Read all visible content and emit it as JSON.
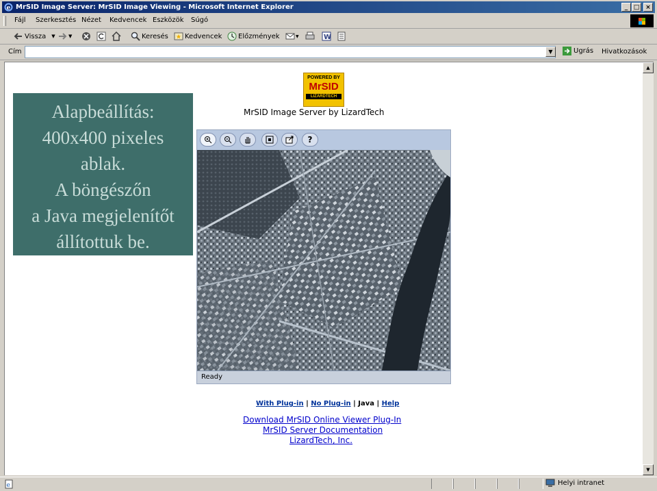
{
  "window": {
    "title": "MrSID Image Server: MrSID Image Viewing - Microsoft Internet Explorer",
    "minimize": "_",
    "maximize": "□",
    "close": "×"
  },
  "menu": [
    "Fájl",
    "Szerkesztés",
    "Nézet",
    "Kedvencek",
    "Eszközök",
    "Súgó"
  ],
  "toolbar": {
    "back": "Vissza",
    "search": "Keresés",
    "favorites": "Kedvencek",
    "history": "Előzmények"
  },
  "address": {
    "label": "Cím",
    "value": "",
    "go": "Ugrás",
    "links": "Hivatkozások"
  },
  "overlay": {
    "lines": [
      "Alapbeállítás:",
      "400x400 pixeles",
      "ablak.",
      "A böngészőn",
      "a Java megjelenítőt",
      "állítottuk be."
    ]
  },
  "logo": {
    "line1": "POWERED BY",
    "line2": "MrSID",
    "line3": "LIZARDTECH"
  },
  "page": {
    "server_title": "MrSID Image Server by LizardTech",
    "viewer_status": "Ready",
    "modes": {
      "with_plugin": "With Plug-in",
      "no_plugin": "No Plug-in",
      "java": "Java",
      "help": "Help",
      "sep": "|"
    },
    "footer_links": [
      "Download MrSID Online Viewer Plug-In",
      "MrSID Server Documentation",
      "LizardTech, Inc."
    ]
  },
  "viewer_tools": {
    "help_label": "?"
  },
  "status": {
    "zone": "Helyi intranet"
  }
}
